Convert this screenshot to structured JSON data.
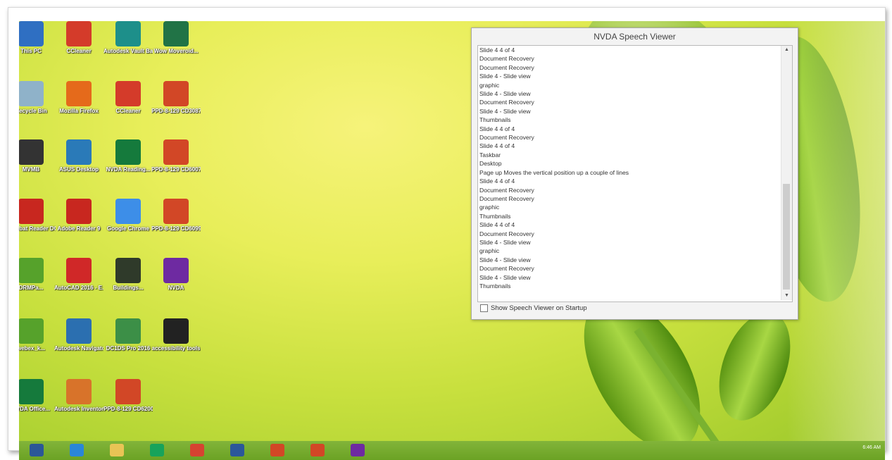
{
  "desktop": {
    "icons": [
      {
        "name": "this-pc-icon",
        "label": "This PC",
        "color": "#2f6fc2"
      },
      {
        "name": "ccleaner-icon",
        "label": "CCleaner",
        "color": "#d43b2a"
      },
      {
        "name": "autocad-vault-icon",
        "label": "Autodesk Vault Ba...",
        "color": "#1d8f8a"
      },
      {
        "name": "excel-file-icon",
        "label": "Wow Moveroid...",
        "color": "#217346"
      },
      {
        "name": "recycle-bin-icon",
        "label": "Recycle Bin",
        "color": "#8fb2c9"
      },
      {
        "name": "firefox-icon",
        "label": "Mozilla Firefox",
        "color": "#e56a1b"
      },
      {
        "name": "ccleaner-icon-2",
        "label": "CCleaner",
        "color": "#d43b2a"
      },
      {
        "name": "ppt-file-icon",
        "label": "PPD-8-129 CD3087",
        "color": "#d24726"
      },
      {
        "name": "folder-icon",
        "label": "MVMB",
        "color": "#333333"
      },
      {
        "name": "asus-icon",
        "label": "ASUS Desktop",
        "color": "#2a7ab8"
      },
      {
        "name": "nvda-shortcut-icon",
        "label": "NVDA Reading...",
        "color": "#157a3c"
      },
      {
        "name": "ppt-file-icon-2",
        "label": "PPD-8-129 CD6007",
        "color": "#d24726"
      },
      {
        "name": "acrobat-reader-icon",
        "label": "Acrobat Reader DC",
        "color": "#c8271f"
      },
      {
        "name": "adobe-reader-icon",
        "label": "Adobe Reader 9",
        "color": "#c8271f"
      },
      {
        "name": "chrome-icon",
        "label": "Google Chrome",
        "color": "#3d8ee8"
      },
      {
        "name": "ppt-file-icon-3",
        "label": "PPD-8-129 CD6099...",
        "color": "#d24726"
      },
      {
        "name": "shortcut-icon",
        "label": "DRMPa...",
        "color": "#56a22b"
      },
      {
        "name": "autocad-icon",
        "label": "AutoCAD 2016 - E...",
        "color": "#d02828"
      },
      {
        "name": "building-icon",
        "label": "Buildings...",
        "color": "#2f3a2a"
      },
      {
        "name": "nvda-icon",
        "label": "NVDA",
        "color": "#6e2aa1"
      },
      {
        "name": "shortcut-icon-2",
        "label": "webex_k...",
        "color": "#56a22b"
      },
      {
        "name": "autodesk-navigator-icon",
        "label": "Autodesk Navigator...",
        "color": "#2b6fb0"
      },
      {
        "name": "autodesk-suite-icon",
        "label": "DC1DS Pro 2016",
        "color": "#3c8f47"
      },
      {
        "name": "accessibility-tools-icon",
        "label": "accessibility tools",
        "color": "#222222"
      },
      {
        "name": "nvda-shortcut-icon-2",
        "label": "NVDA Office...",
        "color": "#157a3c"
      },
      {
        "name": "autodesk-inventor-icon",
        "label": "Autodesk Inventor P...",
        "color": "#d8732a"
      },
      {
        "name": "ppt-file-icon-4",
        "label": "PPD-8-129 CD6200",
        "color": "#d24726"
      }
    ]
  },
  "speech_viewer": {
    "title": "NVDA Speech Viewer",
    "lines": [
      "Slide 4  4 of 4",
      "Document Recovery",
      "Document Recovery",
      "Slide 4 - Slide view",
      "graphic",
      "Slide 4 - Slide view",
      "Document Recovery",
      "Slide 4 - Slide view",
      "Thumbnails",
      "Slide 4  4 of 4",
      "Document Recovery",
      "Slide 4  4 of 4",
      "Taskbar",
      "Desktop",
      "Page up Moves the vertical position up a couple of lines",
      "Slide 4  4 of 4",
      "Document Recovery",
      "Document Recovery",
      "graphic",
      "Thumbnails",
      "Slide 4  4 of 4",
      "Document Recovery",
      "Slide 4 - Slide view",
      "graphic",
      "Slide 4 - Slide view",
      "Document Recovery",
      "Slide 4 - Slide view",
      "Thumbnails"
    ],
    "checkbox_label": "Show Speech Viewer on Startup",
    "checkbox_checked": false,
    "scroll_up": "▲",
    "scroll_down": "▼"
  },
  "taskbar": {
    "items": [
      {
        "name": "start-button",
        "color": "#2b5797"
      },
      {
        "name": "ie-icon",
        "color": "#2a86d8"
      },
      {
        "name": "file-explorer-icon",
        "color": "#e9c455"
      },
      {
        "name": "store-icon",
        "color": "#17a35b"
      },
      {
        "name": "chrome-taskbar-icon",
        "color": "#d64331"
      },
      {
        "name": "word-taskbar-icon",
        "color": "#2b579a"
      },
      {
        "name": "app-taskbar-icon",
        "color": "#d24726"
      },
      {
        "name": "powerpoint-taskbar-icon",
        "color": "#d24726"
      },
      {
        "name": "nvda-taskbar-icon",
        "color": "#6e2aa1"
      }
    ],
    "clock": "6:46 AM"
  }
}
